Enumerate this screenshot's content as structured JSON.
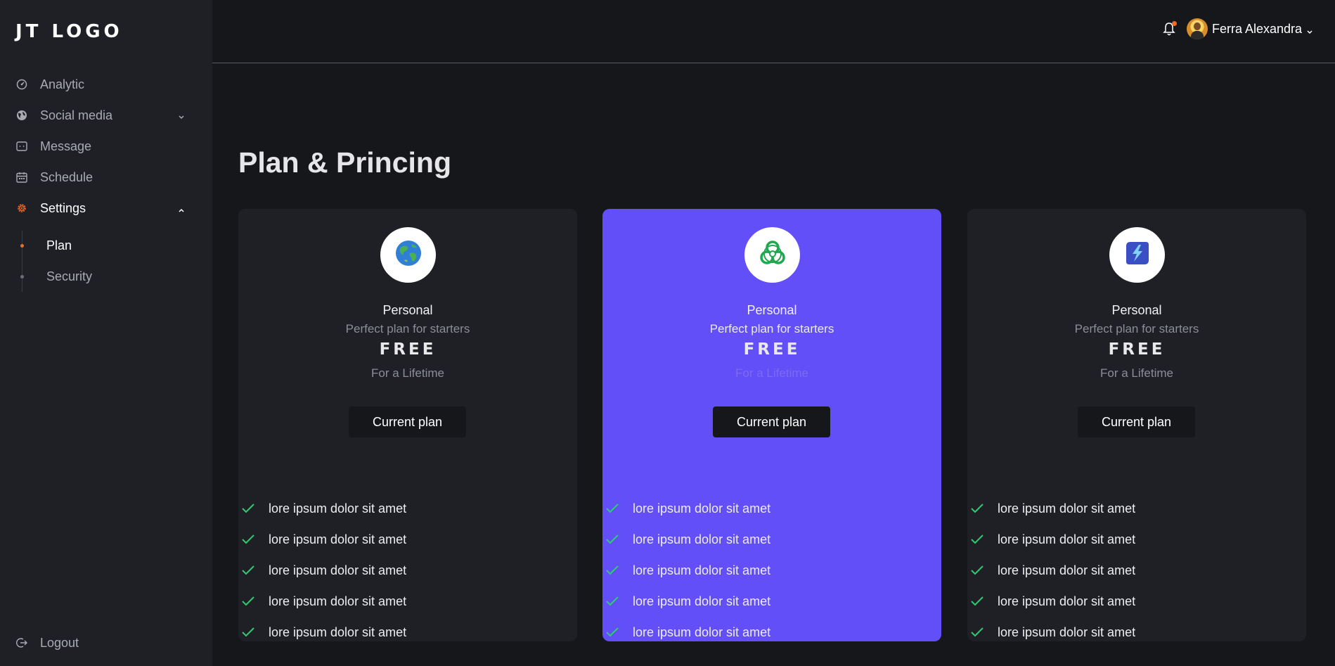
{
  "app": {
    "logo": "JT LOGO"
  },
  "sidebar": {
    "items": [
      {
        "label": "Analytic",
        "icon": "gauge-icon"
      },
      {
        "label": "Social media",
        "icon": "globe-icon"
      },
      {
        "label": "Message",
        "icon": "message-icon"
      },
      {
        "label": "Schedule",
        "icon": "calendar-icon"
      },
      {
        "label": "Settings",
        "icon": "gear-icon"
      }
    ],
    "settings_sub": [
      {
        "label": "Plan"
      },
      {
        "label": "Security"
      }
    ],
    "logout": "Logout"
  },
  "header": {
    "username": "Ferra Alexandra",
    "notification_badge": true
  },
  "main": {
    "title": "Plan & Princing",
    "plans": [
      {
        "icon": "earth-globe-icon",
        "title": "Personal",
        "subtitle": "Perfect plan for starters",
        "price": "FREE",
        "period": "For a Lifetime",
        "button": "Current plan",
        "features": [
          "lore ipsum dolor sit amet",
          "lore ipsum dolor sit amet",
          "lore ipsum dolor sit amet",
          "lore ipsum dolor sit amet",
          "lore ipsum dolor sit amet"
        ]
      },
      {
        "icon": "biohazard-icon",
        "title": "Personal",
        "subtitle": "Perfect plan for starters",
        "price": "FREE",
        "period": "For a Lifetime",
        "button": "Current plan",
        "features": [
          "lore ipsum dolor sit amet",
          "lore ipsum dolor sit amet",
          "lore ipsum dolor sit amet",
          "lore ipsum dolor sit amet",
          "lore ipsum dolor sit amet"
        ]
      },
      {
        "icon": "lightning-bolt-icon",
        "title": "Personal",
        "subtitle": "Perfect plan for starters",
        "price": "FREE",
        "period": "For a Lifetime",
        "button": "Current plan",
        "features": [
          "lore ipsum dolor sit amet",
          "lore ipsum dolor sit amet",
          "lore ipsum dolor sit amet",
          "lore ipsum dolor sit amet",
          "lore ipsum dolor sit amet"
        ]
      }
    ]
  },
  "colors": {
    "accent": "#f26b21",
    "featured_card": "#634ff7",
    "check": "#2ecc71",
    "card_bg": "#1f2026",
    "page_bg": "#16171b"
  }
}
